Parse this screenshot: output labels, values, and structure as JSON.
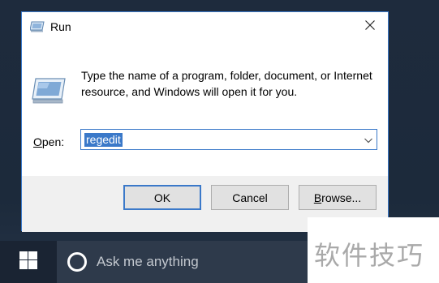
{
  "dialog": {
    "title": "Run",
    "description": "Type the name of a program, folder, document, or Internet resource, and Windows will open it for you.",
    "open_label_underlined": "O",
    "open_label_rest": "pen:",
    "input_value": "regedit",
    "ok_label": "OK",
    "cancel_label": "Cancel",
    "browse_label_underlined": "B",
    "browse_label_rest": "rowse...",
    "icons": {
      "title": "run-icon",
      "main": "run-icon",
      "close": "close-icon",
      "dropdown": "chevron-down-icon"
    }
  },
  "taskbar": {
    "search_placeholder": "Ask me anything",
    "icons": {
      "start": "windows-logo-icon",
      "cortana": "cortana-icon"
    }
  },
  "watermark": {
    "text": "软件技巧"
  },
  "colors": {
    "accent": "#3b79c9",
    "taskbar": "#1a2433",
    "search_box": "#2e3a4b",
    "button_bar": "#f0f0f0"
  }
}
